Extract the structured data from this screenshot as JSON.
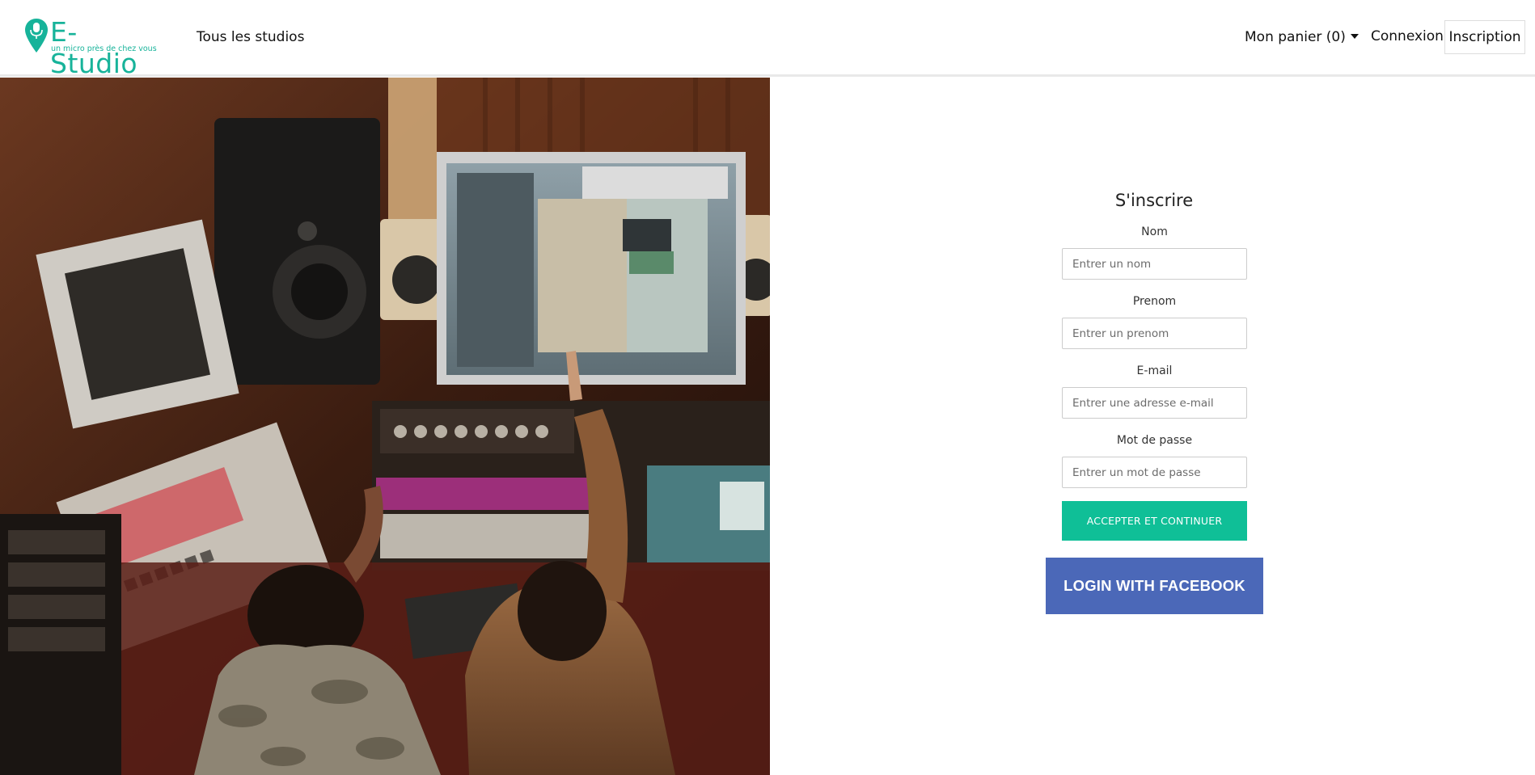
{
  "brand": {
    "name": "E-Studio",
    "tagline": "un micro près de chez vous",
    "color": "#17b39a"
  },
  "nav": {
    "all_studios": "Tous les studios",
    "cart": "Mon panier (0)",
    "login": "Connexion",
    "signup": "Inscription"
  },
  "hero": {
    "description": "recording studio photo"
  },
  "form": {
    "title": "S'inscrire",
    "fields": [
      {
        "label": "Nom",
        "placeholder": "Entrer un nom",
        "value": ""
      },
      {
        "label": "Prenom",
        "placeholder": "Entrer un prenom",
        "value": ""
      },
      {
        "label": "E-mail",
        "placeholder": "Entrer une adresse e-mail",
        "value": ""
      },
      {
        "label": "Mot de passe",
        "placeholder": "Entrer un mot de passe",
        "value": ""
      }
    ],
    "submit_label": "ACCEPTER ET CONTINUER",
    "facebook_label": "LOGIN WITH FACEBOOK"
  },
  "colors": {
    "accent": "#0fbf97",
    "facebook": "#4b68b8"
  }
}
